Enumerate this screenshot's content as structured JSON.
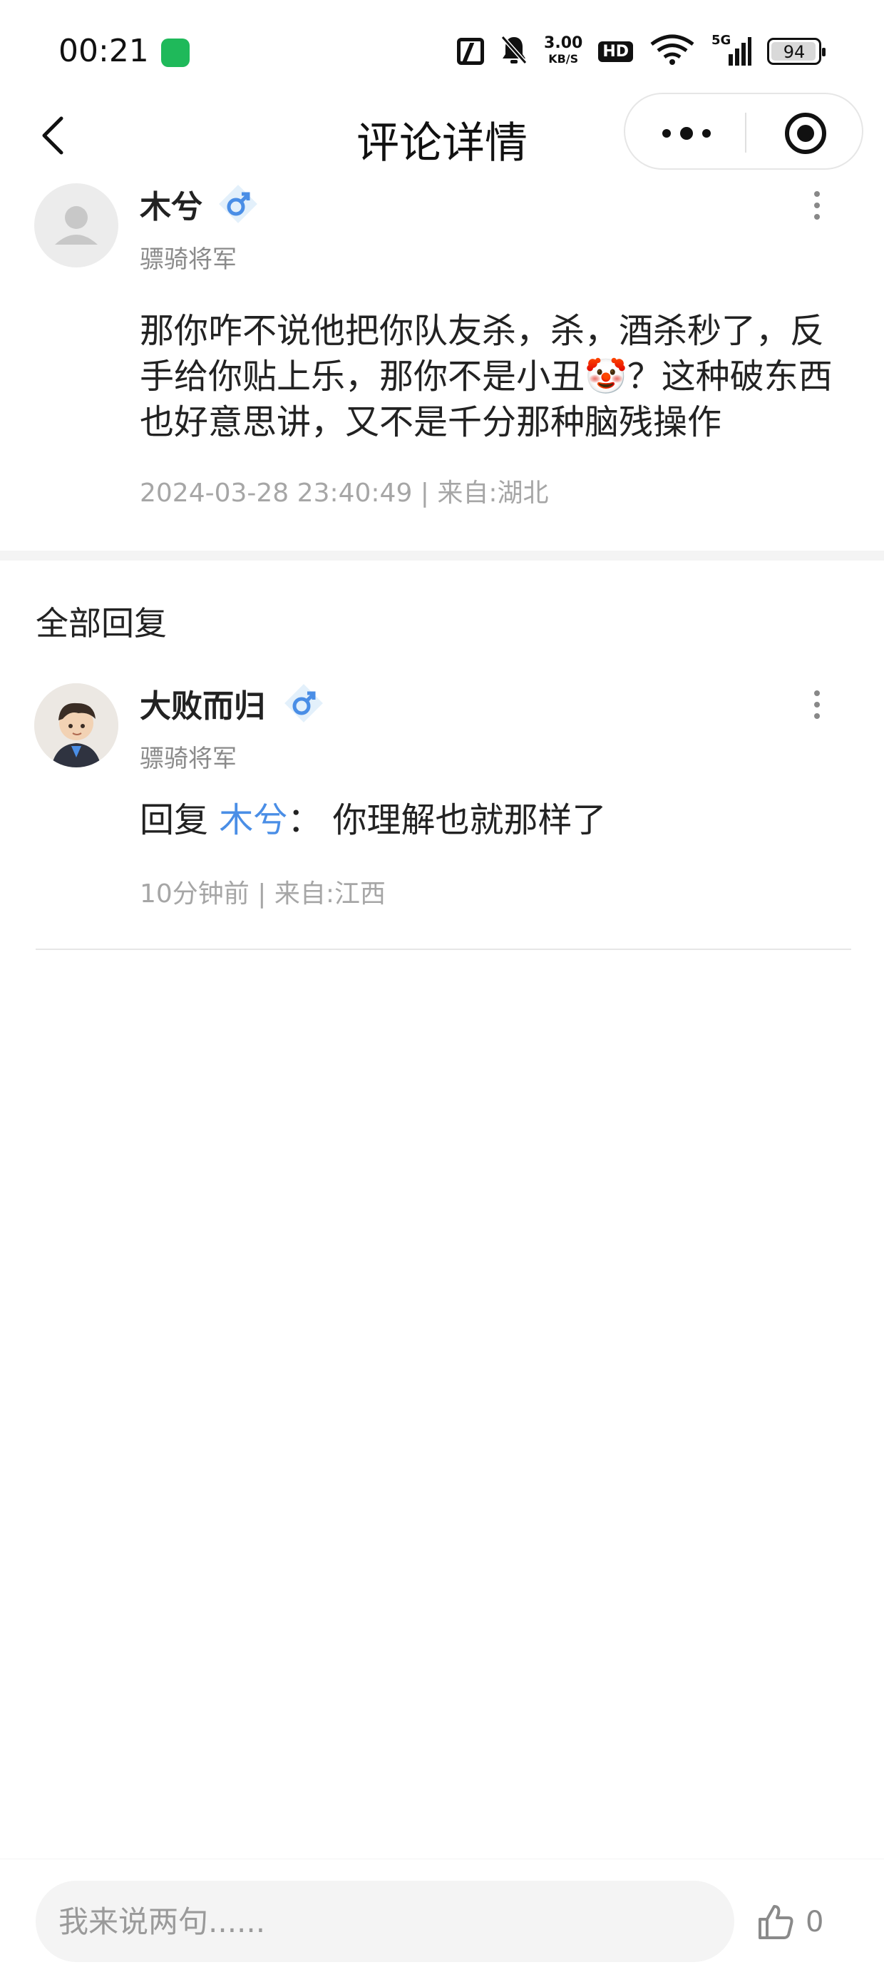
{
  "status_bar": {
    "time": "00:21",
    "speed_value": "3.00",
    "speed_unit": "KB/S",
    "hd": "HD",
    "network": "5G",
    "battery": "94"
  },
  "nav": {
    "title": "评论详情"
  },
  "comment": {
    "username": "木兮",
    "gender_symbol": "♂",
    "rank": "骠骑将军",
    "text": "那你咋不说他把你队友杀，杀，酒杀秒了，反手给你贴上乐，那你不是小丑🤡？这种破东西也好意思讲，又不是千分那种脑残操作",
    "meta": "2024-03-28 23:40:49 | 来自:湖北"
  },
  "replies_section": {
    "title": "全部回复",
    "replies": [
      {
        "username": "大败而归",
        "gender_symbol": "♂",
        "rank": "骠骑将军",
        "reply_prefix": "回复 ",
        "reply_to": "木兮",
        "separator": "：",
        "text": " 你理解也就那样了",
        "meta": "10分钟前 | 来自:江西"
      }
    ]
  },
  "bottom_bar": {
    "input_placeholder": "我来说两句......",
    "like_count": "0"
  },
  "colors": {
    "accent_blue": "#4a8ee6",
    "badge_bg": "#e3f0fb",
    "app_icon": "#1fb95a"
  }
}
